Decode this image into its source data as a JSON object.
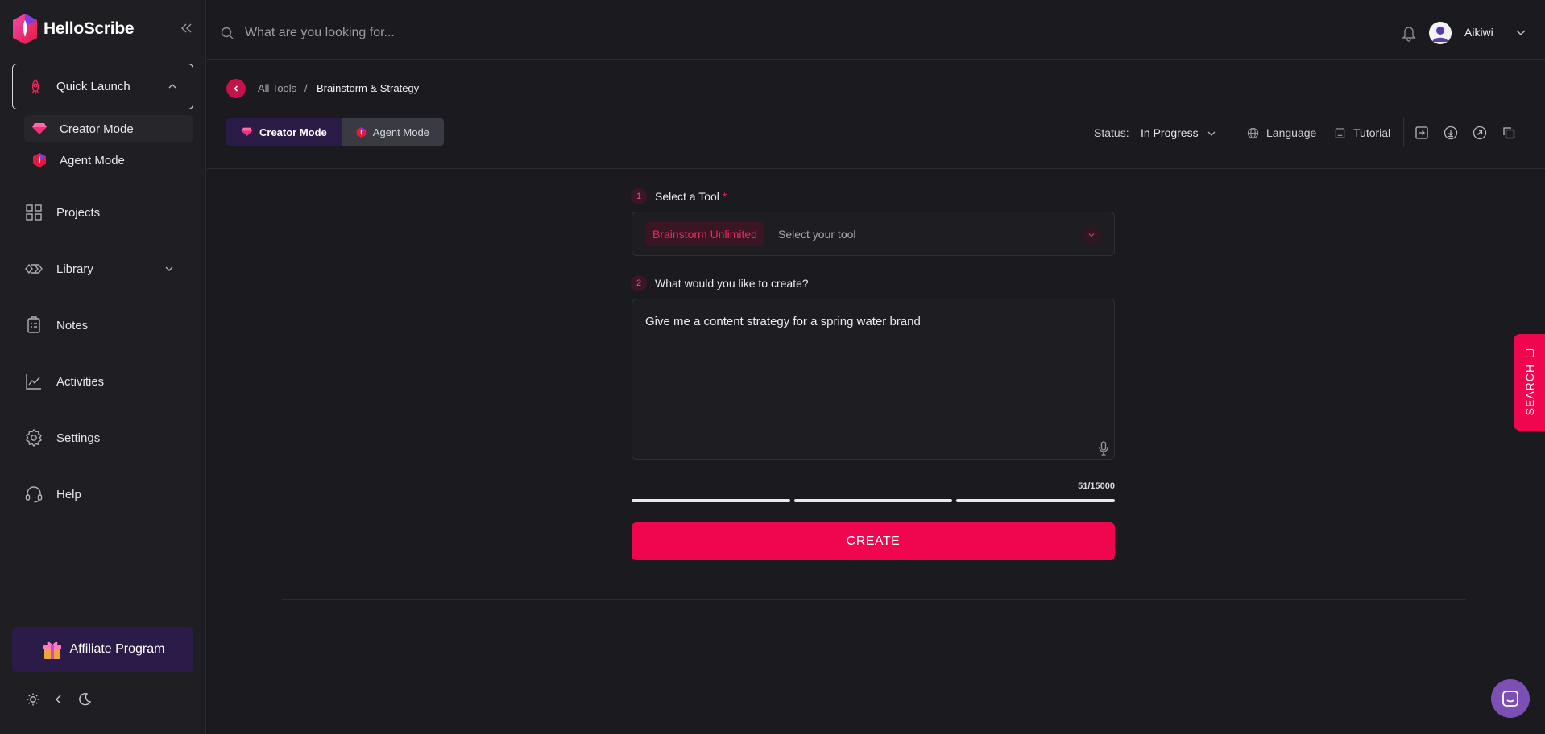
{
  "brand": {
    "name": "HelloScribe"
  },
  "sidebar": {
    "quick_launch": "Quick Launch",
    "sub_items": [
      {
        "label": "Creator Mode"
      },
      {
        "label": "Agent Mode"
      }
    ],
    "items": [
      {
        "label": "Projects"
      },
      {
        "label": "Library"
      },
      {
        "label": "Notes"
      },
      {
        "label": "Activities"
      },
      {
        "label": "Settings"
      },
      {
        "label": "Help"
      }
    ],
    "affiliate": "Affiliate Program"
  },
  "topbar": {
    "search_placeholder": "What are you looking for...",
    "user_name": "Aikiwi"
  },
  "breadcrumb": {
    "all_tools": "All Tools",
    "separator": "/",
    "current": "Brainstorm & Strategy"
  },
  "modes": {
    "creator": "Creator Mode",
    "agent": "Agent Mode"
  },
  "toolbar": {
    "status_label": "Status:",
    "status_value": "In Progress",
    "language": "Language",
    "tutorial": "Tutorial"
  },
  "form": {
    "step1_num": "1",
    "step1_label": "Select a Tool",
    "required_mark": "*",
    "tool_chip": "Brainstorm Unlimited",
    "tool_placeholder": "Select your tool",
    "step2_num": "2",
    "step2_label": "What would you like to create?",
    "prompt": "Give me a content strategy for a spring water brand",
    "counter": "51/15000",
    "create_label": "CREATE"
  },
  "floating": {
    "search_tab": "SEARCH"
  },
  "colors": {
    "accent": "#f0064e",
    "brand_purple": "#2b1c47"
  }
}
